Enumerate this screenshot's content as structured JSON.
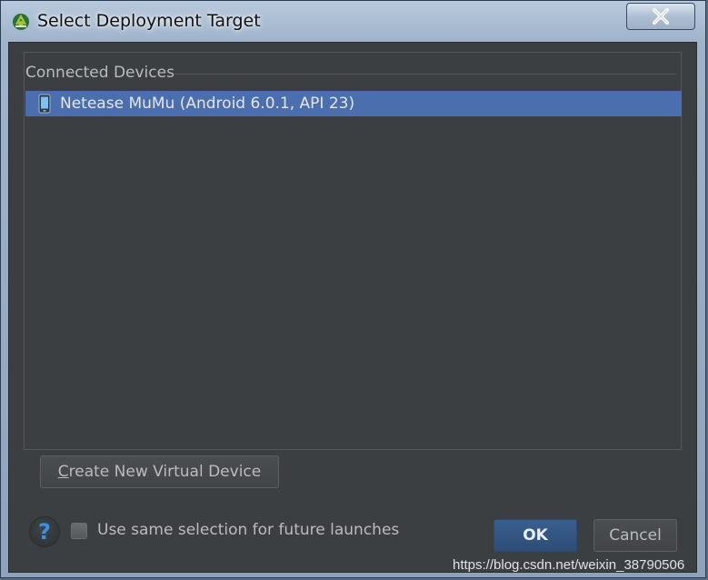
{
  "window": {
    "title": "Select Deployment Target"
  },
  "devices": {
    "group_label": "Connected Devices",
    "items": [
      {
        "label": "Netease MuMu (Android 6.0.1, API 23)",
        "selected": true
      }
    ]
  },
  "actions": {
    "create_mnemonic": "C",
    "create_rest": "reate New Virtual Device",
    "help_glyph": "?",
    "remember_label": "Use same selection for future launches",
    "remember_checked": false,
    "ok_label": "OK",
    "cancel_label": "Cancel"
  },
  "watermark": "https://blog.csdn.net/weixin_38790506",
  "colors": {
    "selection": "#4b6eaf",
    "panel_bg": "#3c3f41",
    "android_green": "#a4c639"
  },
  "icons": {
    "app": "android-studio-icon",
    "close": "close-icon",
    "device": "phone-icon",
    "help": "help-icon"
  }
}
